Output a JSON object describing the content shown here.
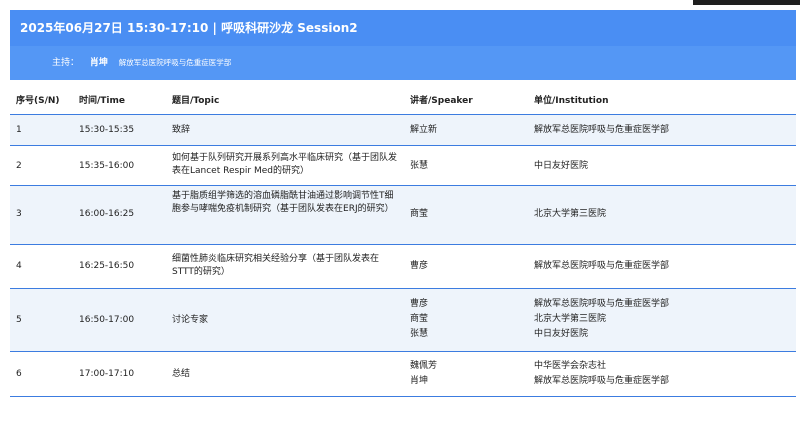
{
  "session": {
    "title": "2025年06月27日 15:30-17:10 | 呼吸科研沙龙 Session2",
    "host_label": "主持：",
    "host_name": "肖坤",
    "host_institution": "解放军总医院呼吸与危重症医学部"
  },
  "columns": {
    "sn": "序号(S/N)",
    "time": "时间/Time",
    "topic": "题目/Topic",
    "speaker": "讲者/Speaker",
    "institution": "单位/Institution"
  },
  "rows": [
    {
      "sn": "1",
      "time": "15:30-15:35",
      "topic": "致辞",
      "speakers": [
        "解立新"
      ],
      "institutions": [
        "解放军总医院呼吸与危重症医学部"
      ]
    },
    {
      "sn": "2",
      "time": "15:35-16:00",
      "topic": "如何基于队列研究开展系列高水平临床研究（基于团队发表在Lancet Respir Med的研究）",
      "speakers": [
        "张慧"
      ],
      "institutions": [
        "中日友好医院"
      ]
    },
    {
      "sn": "3",
      "time": "16:00-16:25",
      "topic": "基于脂质组学筛选的溶血磷脂酰甘油通过影响调节性T细胞参与哮喘免疫机制研究（基于团队发表在ERJ的研究）",
      "speakers": [
        "商莹"
      ],
      "institutions": [
        "北京大学第三医院"
      ]
    },
    {
      "sn": "4",
      "time": "16:25-16:50",
      "topic": "细菌性肺炎临床研究相关经验分享（基于团队发表在STTT的研究）",
      "speakers": [
        "曹彦"
      ],
      "institutions": [
        "解放军总医院呼吸与危重症医学部"
      ]
    },
    {
      "sn": "5",
      "time": "16:50-17:00",
      "topic": "讨论专家",
      "speakers": [
        "曹彦",
        "商莹",
        "张慧"
      ],
      "institutions": [
        "解放军总医院呼吸与危重症医学部",
        "北京大学第三医院",
        "中日友好医院"
      ]
    },
    {
      "sn": "6",
      "time": "17:00-17:10",
      "topic": "总结",
      "speakers": [
        "魏佩芳",
        "肖坤"
      ],
      "institutions": [
        "中华医学会杂志社",
        "解放军总医院呼吸与危重症医学部"
      ]
    }
  ]
}
